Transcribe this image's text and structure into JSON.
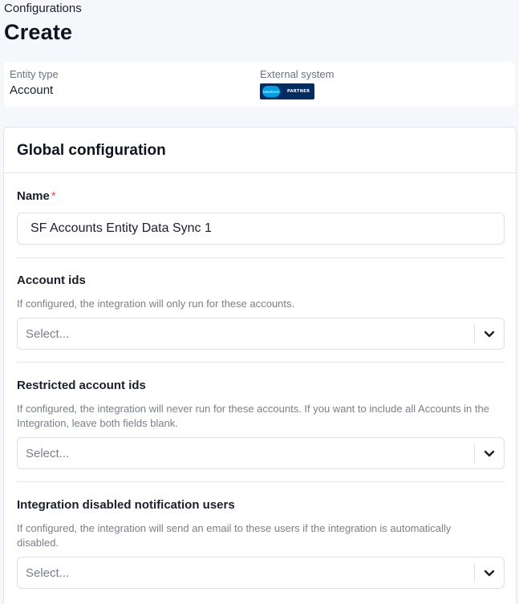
{
  "breadcrumb": "Configurations",
  "page_title": "Create",
  "info": {
    "entity_type_label": "Entity type",
    "entity_type_value": "Account",
    "external_system_label": "External system",
    "badge_cloud_text": "salesforce",
    "badge_partner_text": "PARTNER"
  },
  "config": {
    "title": "Global configuration",
    "name_field": {
      "label": "Name",
      "required_mark": "*",
      "value": "SF Accounts Entity Data Sync 1"
    },
    "account_ids": {
      "label": "Account ids",
      "help": "If configured, the integration will only run for these accounts.",
      "placeholder": "Select..."
    },
    "restricted_account_ids": {
      "label": "Restricted account ids",
      "help": "If configured, the integration will never run for these accounts. If you want to include all Accounts in the Integration, leave both fields blank.",
      "placeholder": "Select..."
    },
    "notification_users": {
      "label": "Integration disabled notification users",
      "help": "If configured, the integration will send an email to these users if the integration is automatically disabled.",
      "placeholder": "Select..."
    }
  },
  "colors": {
    "required": "#e5484d",
    "badge_bg": "#032d60",
    "badge_cloud": "#00a1e0"
  }
}
